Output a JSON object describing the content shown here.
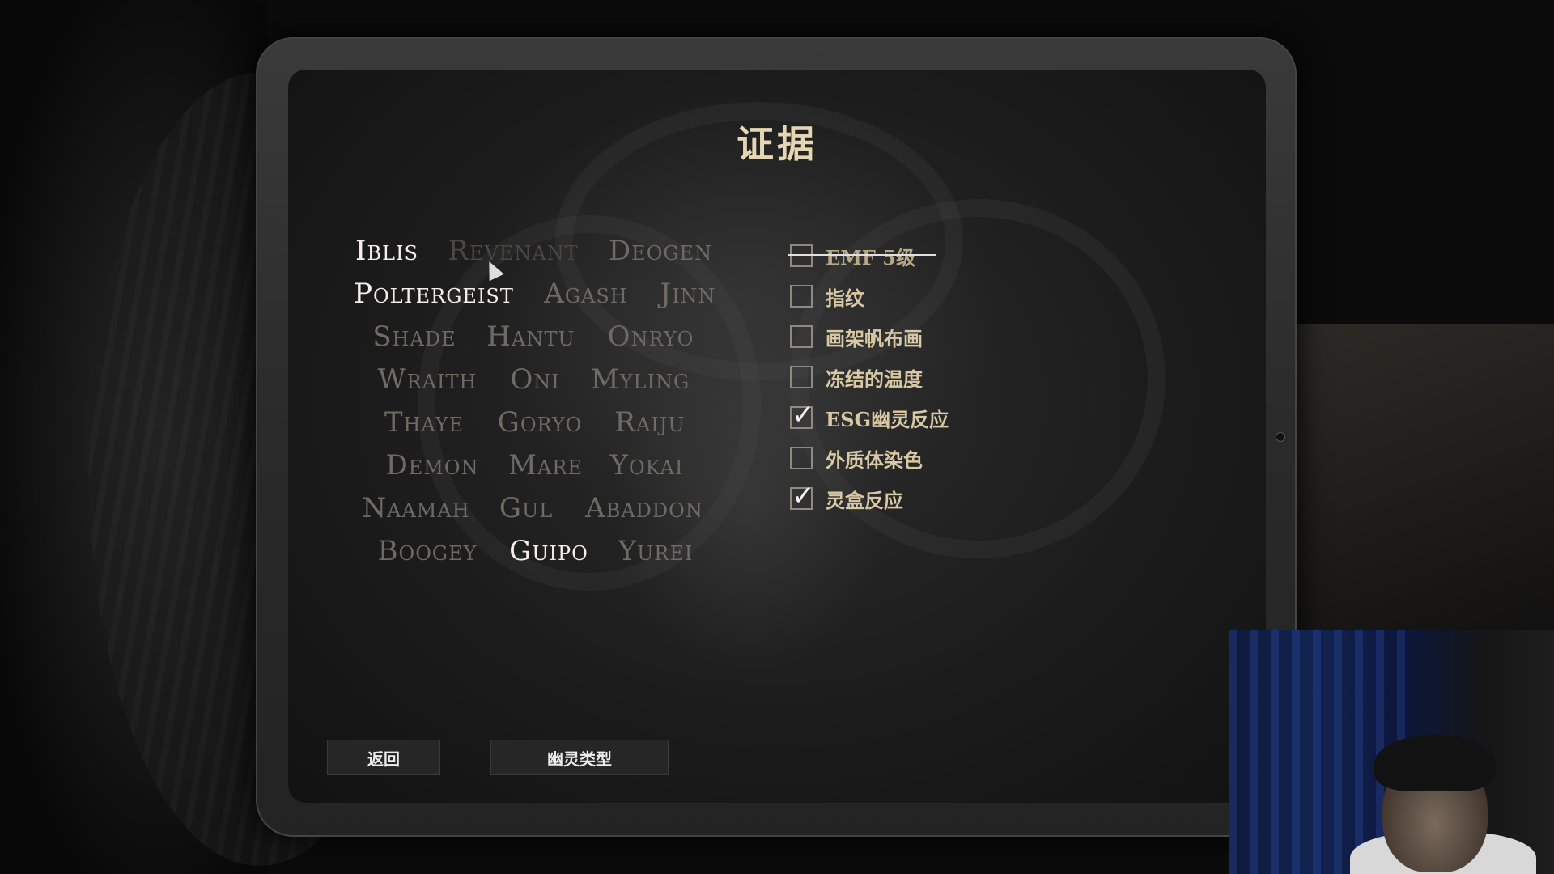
{
  "title": "证据",
  "ghosts": [
    {
      "name": "Iblis",
      "state": "active"
    },
    {
      "name": "Revenant",
      "state": "dim"
    },
    {
      "name": "Deogen",
      "state": "normal"
    },
    {
      "name": "Poltergeist",
      "state": "active"
    },
    {
      "name": "Agash",
      "state": "normal"
    },
    {
      "name": "Jinn",
      "state": "normal"
    },
    {
      "name": "Shade",
      "state": "normal"
    },
    {
      "name": "Hantu",
      "state": "normal"
    },
    {
      "name": "Onryo",
      "state": "normal"
    },
    {
      "name": "Wraith",
      "state": "normal"
    },
    {
      "name": "Oni",
      "state": "normal"
    },
    {
      "name": "Myling",
      "state": "normal"
    },
    {
      "name": "Thaye",
      "state": "normal"
    },
    {
      "name": "Goryo",
      "state": "normal"
    },
    {
      "name": "Raiju",
      "state": "normal"
    },
    {
      "name": "Demon",
      "state": "normal"
    },
    {
      "name": "Mare",
      "state": "normal"
    },
    {
      "name": "Yokai",
      "state": "normal"
    },
    {
      "name": "Naamah",
      "state": "normal"
    },
    {
      "name": "Gul",
      "state": "normal"
    },
    {
      "name": "Abaddon",
      "state": "normal"
    },
    {
      "name": "Boogey",
      "state": "normal"
    },
    {
      "name": "Guipo",
      "state": "active"
    },
    {
      "name": "Yurei",
      "state": "normal"
    }
  ],
  "evidence": [
    {
      "label": "EMF 5级",
      "checked": false,
      "excluded": true
    },
    {
      "label": "指纹",
      "checked": false,
      "excluded": false
    },
    {
      "label": "画架帆布画",
      "checked": false,
      "excluded": false
    },
    {
      "label": "冻结的温度",
      "checked": false,
      "excluded": false
    },
    {
      "label": "ESG幽灵反应",
      "checked": true,
      "excluded": false
    },
    {
      "label": "外质体染色",
      "checked": false,
      "excluded": false
    },
    {
      "label": "灵盒反应",
      "checked": true,
      "excluded": false
    }
  ],
  "buttons": {
    "back": "返回",
    "ghost_types": "幽灵类型"
  },
  "check_glyph": "✓"
}
